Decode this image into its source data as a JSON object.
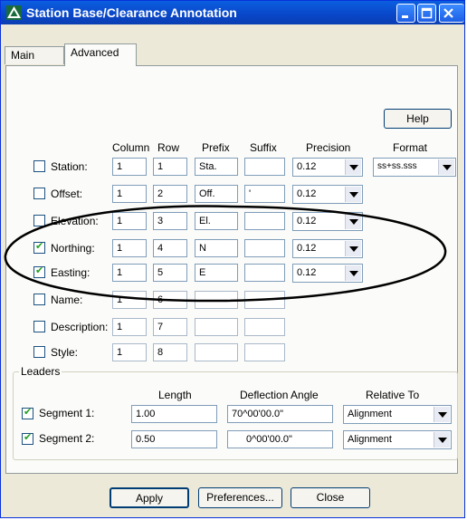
{
  "window": {
    "title": "Station Base/Clearance Annotation"
  },
  "tabs": [
    {
      "label": "Main"
    },
    {
      "label": "Advanced"
    }
  ],
  "help_label": "Help",
  "headers": {
    "column": "Column",
    "row": "Row",
    "prefix": "Prefix",
    "suffix": "Suffix",
    "precision": "Precision",
    "format": "Format"
  },
  "rows": [
    {
      "label": "Station:",
      "checked": false,
      "column": "1",
      "row": "1",
      "prefix": "Sta.",
      "suffix": "",
      "precision": "0.12",
      "format": "ss+ss.sss"
    },
    {
      "label": "Offset:",
      "checked": false,
      "column": "1",
      "row": "2",
      "prefix": "Off.",
      "suffix": "'",
      "precision": "0.12"
    },
    {
      "label": "Elevation:",
      "checked": false,
      "column": "1",
      "row": "3",
      "prefix": "El.",
      "suffix": "",
      "precision": "0.12"
    },
    {
      "label": "Northing:",
      "checked": true,
      "column": "1",
      "row": "4",
      "prefix": "N",
      "suffix": "",
      "precision": "0.12"
    },
    {
      "label": "Easting:",
      "checked": true,
      "column": "1",
      "row": "5",
      "prefix": "E",
      "suffix": "",
      "precision": "0.12"
    },
    {
      "label": "Name:",
      "checked": false,
      "column": "1",
      "row": "6",
      "prefix": "",
      "suffix": ""
    },
    {
      "label": "Description:",
      "checked": false,
      "column": "1",
      "row": "7",
      "prefix": "",
      "suffix": ""
    },
    {
      "label": "Style:",
      "checked": false,
      "column": "1",
      "row": "8",
      "prefix": "",
      "suffix": ""
    }
  ],
  "leaders": {
    "title": "Leaders",
    "headers": {
      "length": "Length",
      "deflection": "Deflection Angle",
      "relative": "Relative To"
    },
    "segments": [
      {
        "label": "Segment 1:",
        "checked": true,
        "length": "1.00",
        "deflection": "70^00'00.0\"",
        "relative": "Alignment"
      },
      {
        "label": "Segment 2:",
        "checked": true,
        "length": "0.50",
        "deflection": "0^00'00.0\"",
        "relative": "Alignment"
      }
    ]
  },
  "footer": {
    "apply_label": "Apply",
    "preferences_label": "Preferences...",
    "close_label": "Close"
  },
  "colors": {
    "titlebar": "#0a4fd6",
    "dialog_bg": "#ece9d8",
    "panel_bg": "#fbfbf9",
    "annotation_ellipse": "#000000"
  }
}
